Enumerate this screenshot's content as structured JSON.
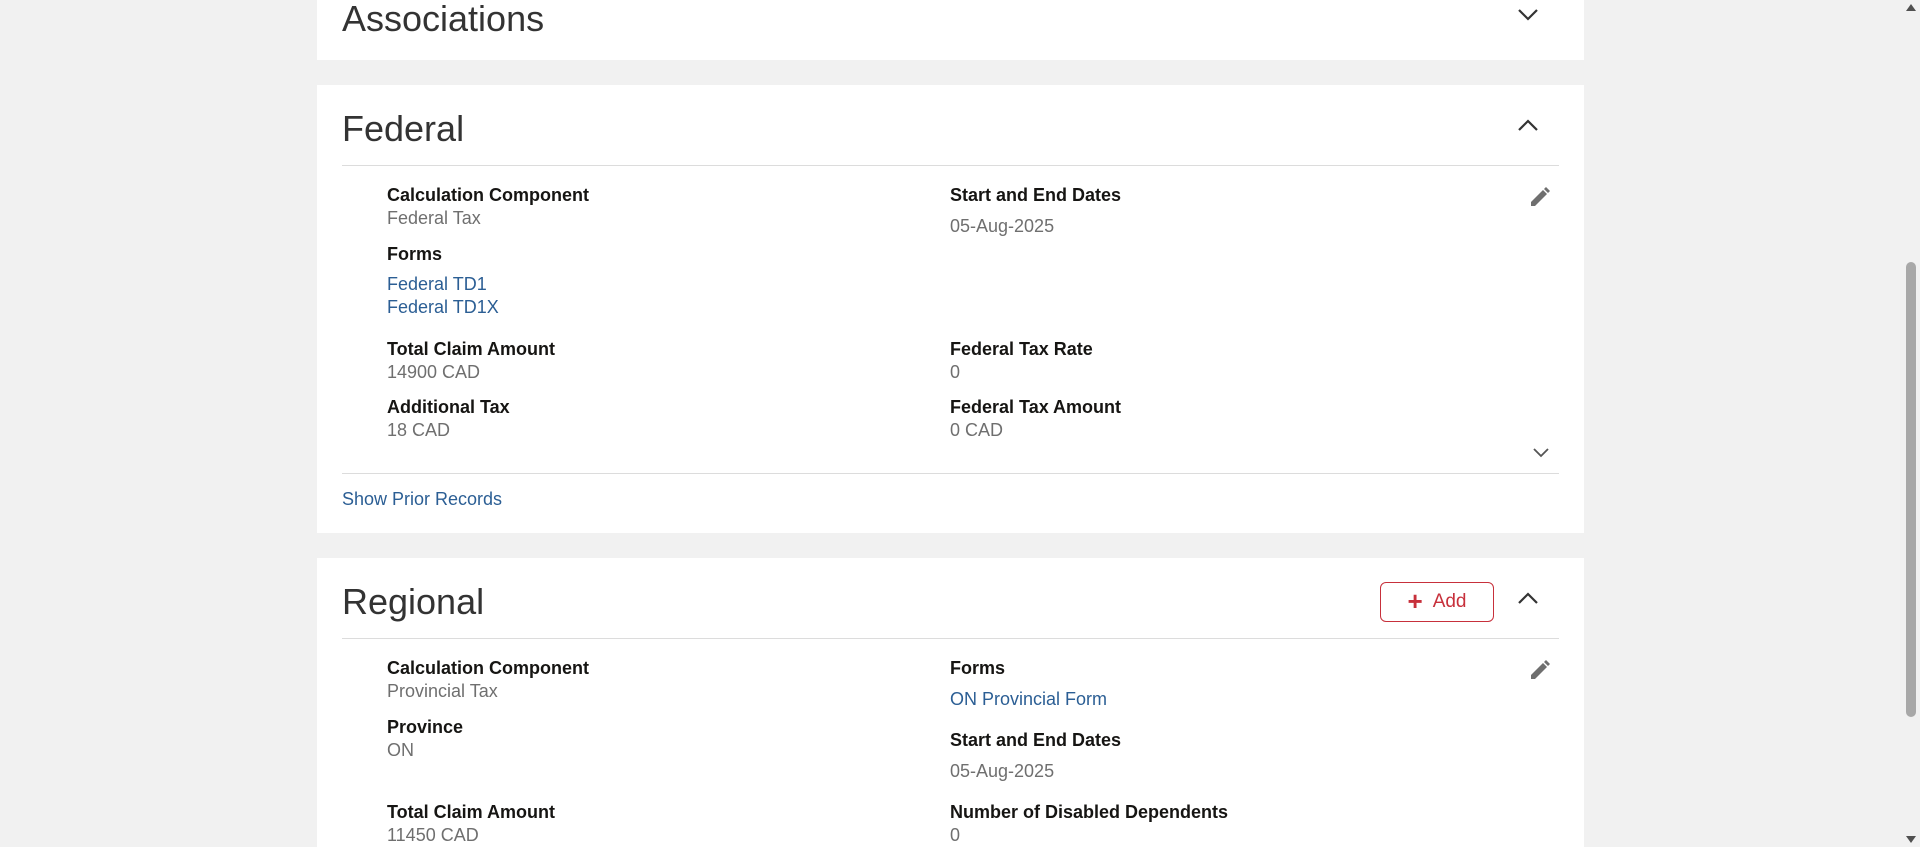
{
  "associations": {
    "title": "Associations"
  },
  "federal": {
    "title": "Federal",
    "calc_component_label": "Calculation Component",
    "calc_component_value": "Federal Tax",
    "dates_label": "Start and End Dates",
    "dates_value": "05-Aug-2025",
    "forms_label": "Forms",
    "forms": [
      "Federal TD1",
      "Federal TD1X"
    ],
    "total_claim_label": "Total Claim Amount",
    "total_claim_value": "14900 CAD",
    "tax_rate_label": "Federal Tax Rate",
    "tax_rate_value": "0",
    "additional_tax_label": "Additional Tax",
    "additional_tax_value": "18 CAD",
    "tax_amount_label": "Federal Tax Amount",
    "tax_amount_value": "0 CAD",
    "show_prior": "Show Prior Records"
  },
  "regional": {
    "title": "Regional",
    "add_label": "Add",
    "calc_component_label": "Calculation Component",
    "calc_component_value": "Provincial Tax",
    "forms_label": "Forms",
    "form_link": "ON Provincial Form",
    "province_label": "Province",
    "province_value": "ON",
    "dates_label": "Start and End Dates",
    "dates_value": "05-Aug-2025",
    "total_claim_label": "Total Claim Amount",
    "total_claim_value": "11450 CAD",
    "disabled_dependents_label": "Number of Disabled Dependents",
    "disabled_dependents_value": "0"
  },
  "colors": {
    "link": "#2b5e94",
    "accent": "#c7303b",
    "background": "#f1f1f1"
  },
  "icons": {
    "collapse": "chevron-up-icon",
    "expand": "chevron-down-icon",
    "edit": "pencil-icon",
    "add": "plus-icon"
  }
}
